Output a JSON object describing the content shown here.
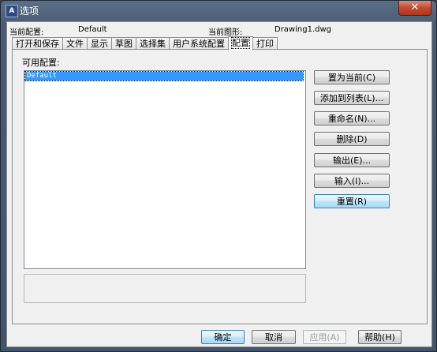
{
  "window": {
    "title": "选项",
    "app_icon_text": "A",
    "close_glyph": "✕"
  },
  "header": {
    "current_profile_label": "当前配置:",
    "current_profile_value": "Default",
    "current_drawing_label": "当前图形:",
    "current_drawing_value": "Drawing1.dwg"
  },
  "tabs": [
    {
      "label": "打开和保存"
    },
    {
      "label": "文件"
    },
    {
      "label": "显示"
    },
    {
      "label": "草图"
    },
    {
      "label": "选择集"
    },
    {
      "label": "用户系统配置"
    },
    {
      "label": "配置",
      "active": true
    },
    {
      "label": "打印"
    }
  ],
  "profiles": {
    "label": "可用配置:",
    "items": [
      "Default"
    ],
    "selected": "Default"
  },
  "side_buttons": {
    "set_current": "置为当前(C)",
    "add_to_list": "添加到列表(L)...",
    "rename": "重命名(N)...",
    "delete": "删除(D)",
    "export": "输出(E)...",
    "import": "输入(I)...",
    "reset": "重置(R)"
  },
  "footer": {
    "ok": "确定",
    "cancel": "取消",
    "apply": "应用(A)",
    "help": "帮助(H)"
  }
}
